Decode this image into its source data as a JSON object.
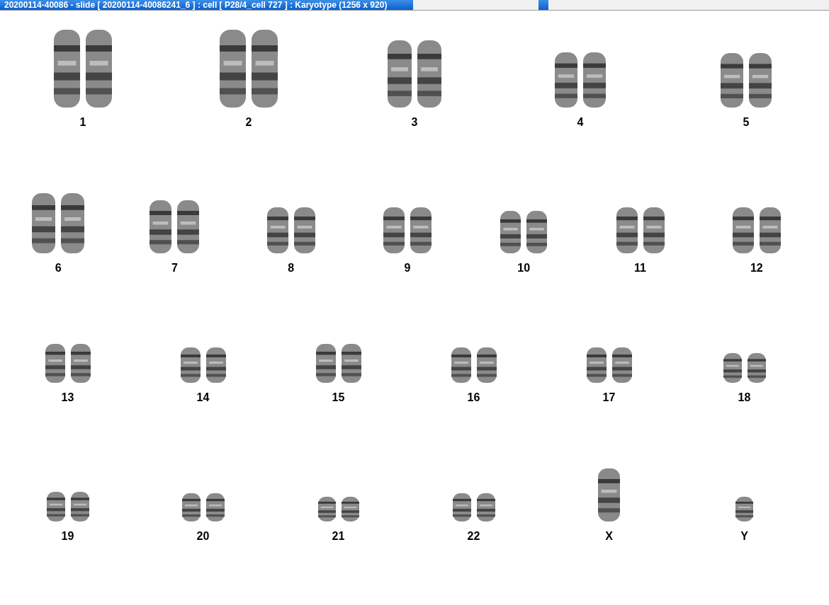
{
  "window": {
    "title": "20200114-40086 - slide [  20200114-40086241_6 ] : cell [ P28/4_cell 727 ] : Karyotype  (1256 x 920)"
  },
  "karyotype": {
    "rows": [
      {
        "items": [
          {
            "label": "1",
            "kind": "pair"
          },
          {
            "label": "2",
            "kind": "pair"
          },
          {
            "label": "3",
            "kind": "pair"
          },
          {
            "label": "4",
            "kind": "pair"
          },
          {
            "label": "5",
            "kind": "pair"
          }
        ]
      },
      {
        "items": [
          {
            "label": "6",
            "kind": "pair"
          },
          {
            "label": "7",
            "kind": "pair"
          },
          {
            "label": "8",
            "kind": "pair"
          },
          {
            "label": "9",
            "kind": "pair"
          },
          {
            "label": "10",
            "kind": "pair"
          },
          {
            "label": "11",
            "kind": "pair"
          },
          {
            "label": "12",
            "kind": "pair"
          }
        ]
      },
      {
        "items": [
          {
            "label": "13",
            "kind": "pair"
          },
          {
            "label": "14",
            "kind": "pair"
          },
          {
            "label": "15",
            "kind": "pair"
          },
          {
            "label": "16",
            "kind": "pair"
          },
          {
            "label": "17",
            "kind": "pair"
          },
          {
            "label": "18",
            "kind": "pair"
          }
        ]
      },
      {
        "items": [
          {
            "label": "19",
            "kind": "pair"
          },
          {
            "label": "20",
            "kind": "pair"
          },
          {
            "label": "21",
            "kind": "pair"
          },
          {
            "label": "22",
            "kind": "pair"
          },
          {
            "label": "X",
            "kind": "single"
          },
          {
            "label": "Y",
            "kind": "single"
          }
        ]
      }
    ]
  }
}
